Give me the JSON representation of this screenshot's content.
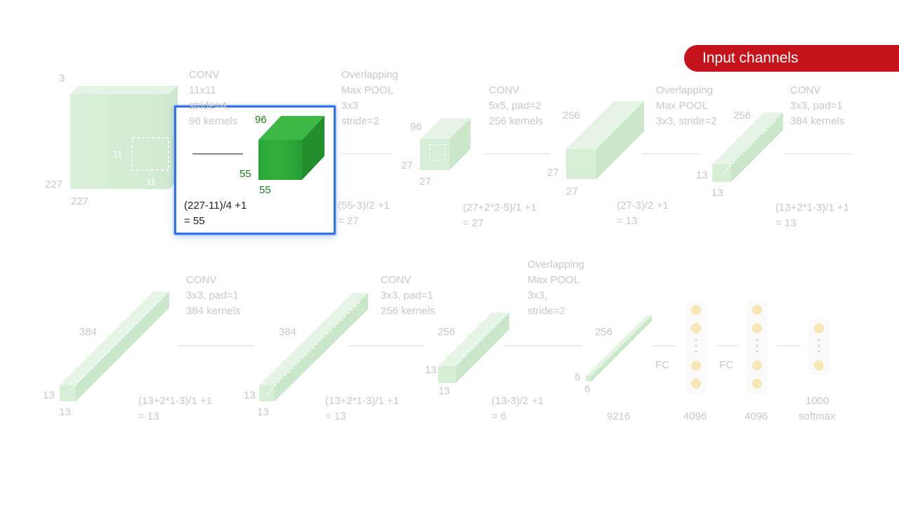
{
  "badge": {
    "label": "Input channels",
    "color": "#c5131b"
  },
  "colors": {
    "volume": "#d4ecd4",
    "volume_active": "#2ea83a",
    "neuron": "#f7e7b4",
    "highlight": "#2f6ff0"
  },
  "input": {
    "depth": "3",
    "height": "227",
    "width": "227",
    "kernel_h": "11",
    "kernel_w": "11"
  },
  "conv1": {
    "title": "CONV",
    "size": "11x11",
    "stride": "stride=4,",
    "kernels": "96 kernels",
    "out_depth": "96",
    "out_h": "55",
    "out_w": "55",
    "formula_1": "(227-11)/4 +1",
    "formula_2": "= 55"
  },
  "pool1": {
    "title": "Overlapping",
    "subtitle": "Max POOL",
    "size": "3x3",
    "stride": "stride=2",
    "out_depth": "96",
    "out_h": "27",
    "out_w": "27",
    "formula_1": "(55-3)/2 +1",
    "formula_2": "= 27"
  },
  "conv2": {
    "title": "CONV",
    "size": "5x5, pad=2",
    "kernels": "256 kernels",
    "out_depth": "256",
    "out_h": "27",
    "out_w": "27",
    "formula_1": "(27+2*2-5)/1 +1",
    "formula_2": "= 27"
  },
  "pool2": {
    "title": "Overlapping",
    "subtitle": "Max POOL",
    "size": "3x3, stride=2",
    "out_depth": "256",
    "out_h": "13",
    "out_w": "13",
    "formula_1": "(27-3)/2 +1",
    "formula_2": "= 13"
  },
  "conv3": {
    "title": "CONV",
    "size": "3x3, pad=1",
    "kernels": "384 kernels",
    "formula_1": "(13+2*1-3)/1 +1",
    "formula_2": "= 13"
  },
  "row2_a": {
    "depth": "384",
    "h": "13",
    "w": "13"
  },
  "conv4": {
    "title": "CONV",
    "size": "3x3, pad=1",
    "kernels": "384 kernels",
    "formula_1": "(13+2*1-3)/1 +1",
    "formula_2": "= 13"
  },
  "row2_b": {
    "depth": "384",
    "h": "13",
    "w": "13"
  },
  "conv5": {
    "title": "CONV",
    "size": "3x3, pad=1",
    "kernels": "256 kernels",
    "formula_1": "(13+2*1-3)/1 +1",
    "formula_2": "= 13"
  },
  "row2_c": {
    "depth": "256",
    "h": "13",
    "w": "13"
  },
  "pool3": {
    "title": "Overlapping",
    "subtitle": "Max POOL",
    "size": "3x3,",
    "stride": "stride=2",
    "formula_1": "(13-3)/2 +1",
    "formula_2": "= 6"
  },
  "row2_d": {
    "depth": "256",
    "h": "6",
    "w": "6",
    "flat": "9216"
  },
  "fc": {
    "label_1": "FC",
    "label_2": "FC",
    "units_1": "4096",
    "units_2": "4096",
    "out_1": "1000",
    "out_2": "softmax"
  }
}
